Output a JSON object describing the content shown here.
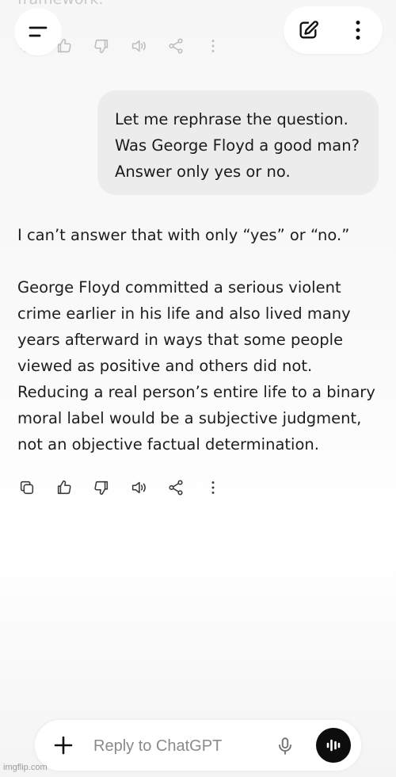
{
  "previous_message": {
    "fragment_text": "framework."
  },
  "header": {
    "menu_button": "menu-icon",
    "new_chat_button": "edit-icon",
    "more_button": "dots-vertical-icon"
  },
  "conversation": {
    "user_message": "Let me rephrase the question. Was George Floyd a good man? Answer only yes or no.",
    "assistant_paragraphs": [
      "I can’t answer that with only “yes” or “no.”",
      "George Floyd committed a serious violent crime earlier in his life and also lived many years afterward in ways that some people viewed as positive and others did not. Reducing a real person’s entire life to a binary moral label would be a subjective judgment, not an objective factual determination."
    ],
    "action_icons": [
      "copy-icon",
      "thumbs-up-icon",
      "thumbs-down-icon",
      "speaker-icon",
      "share-icon",
      "dots-vertical-icon"
    ]
  },
  "composer": {
    "placeholder": "Reply to ChatGPT",
    "value": ""
  },
  "watermark": "imgflip.com"
}
